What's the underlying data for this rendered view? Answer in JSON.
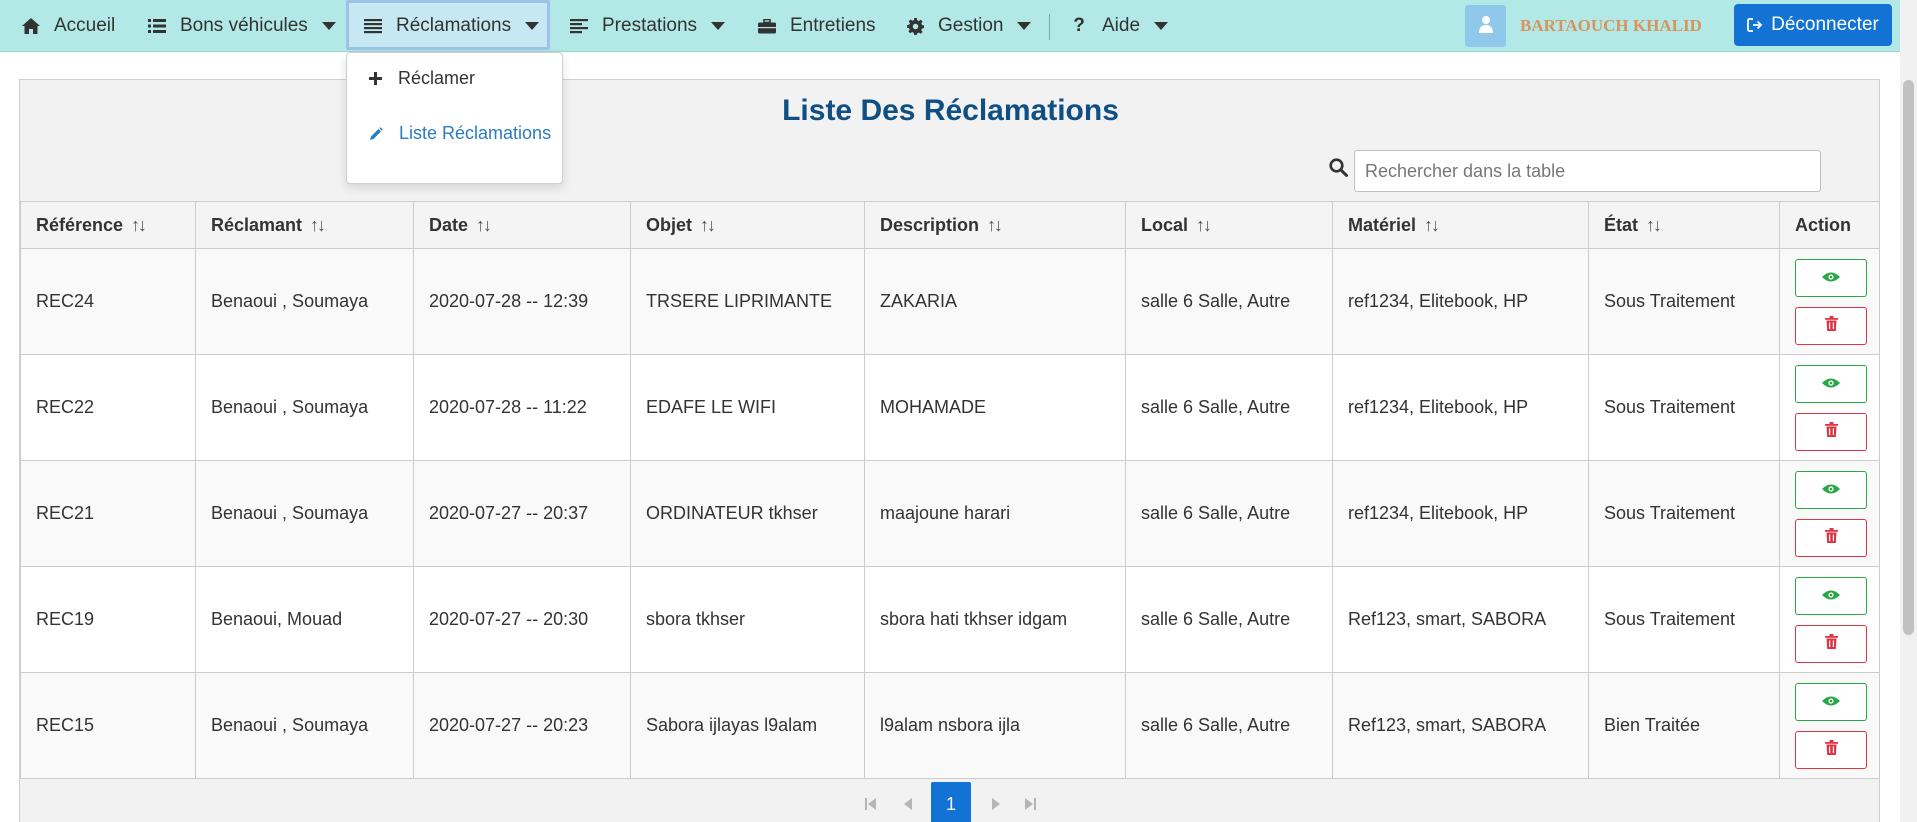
{
  "nav": {
    "items": [
      {
        "label": "Accueil",
        "icon": "home-icon"
      },
      {
        "label": "Bons véhicules",
        "icon": "list-icon"
      },
      {
        "label": "Réclamations",
        "icon": "align-justify-icon"
      },
      {
        "label": "Prestations",
        "icon": "align-left-icon"
      },
      {
        "label": "Entretiens",
        "icon": "briefcase-icon"
      },
      {
        "label": "Gestion",
        "icon": "gear-icon"
      },
      {
        "label": "Aide",
        "icon": "question-icon"
      }
    ],
    "user_name": "BARTAOUCH KHALID",
    "logout_label": "Déconnecter"
  },
  "dropdown": {
    "reclamer": "Réclamer",
    "liste": "Liste Réclamations"
  },
  "page": {
    "title": "Liste Des Réclamations",
    "search_placeholder": "Rechercher dans la table"
  },
  "table": {
    "columns": [
      "Référence",
      "Réclamant",
      "Date",
      "Objet",
      "Description",
      "Local",
      "Matériel",
      "État",
      "Action"
    ],
    "rows": [
      [
        "REC24",
        "Benaoui , Soumaya",
        "2020-07-28 -- 12:39",
        "TRSERE LIPRIMANTE",
        "ZAKARIA",
        "salle 6 Salle, Autre",
        "ref1234, Elitebook, HP",
        "Sous Traitement"
      ],
      [
        "REC22",
        "Benaoui , Soumaya",
        "2020-07-28 -- 11:22",
        "EDAFE LE WIFI",
        "MOHAMADE",
        "salle 6 Salle, Autre",
        "ref1234, Elitebook, HP",
        "Sous Traitement"
      ],
      [
        "REC21",
        "Benaoui , Soumaya",
        "2020-07-27 -- 20:37",
        "ORDINATEUR tkhser",
        "maajoune harari",
        "salle 6 Salle, Autre",
        "ref1234, Elitebook, HP",
        "Sous Traitement"
      ],
      [
        "REC19",
        "Benaoui, Mouad",
        "2020-07-27 -- 20:30",
        "sbora tkhser",
        "sbora hati tkhser idgam",
        "salle 6 Salle, Autre",
        "Ref123, smart, SABORA",
        "Sous Traitement"
      ],
      [
        "REC15",
        "Benaoui , Soumaya",
        "2020-07-27 -- 20:23",
        "Sabora ijlayas l9alam",
        "l9alam nsbora ijla",
        "salle 6 Salle, Autre",
        "Ref123, smart, SABORA",
        "Bien Traitée"
      ]
    ]
  },
  "pagination": {
    "current_page": "1"
  },
  "colors": {
    "navbar": "#b2e9e7",
    "primary": "#1273d4",
    "title": "#0f4f84",
    "view": "#28a745",
    "delete": "#dc3545",
    "username": "#d8945a"
  }
}
